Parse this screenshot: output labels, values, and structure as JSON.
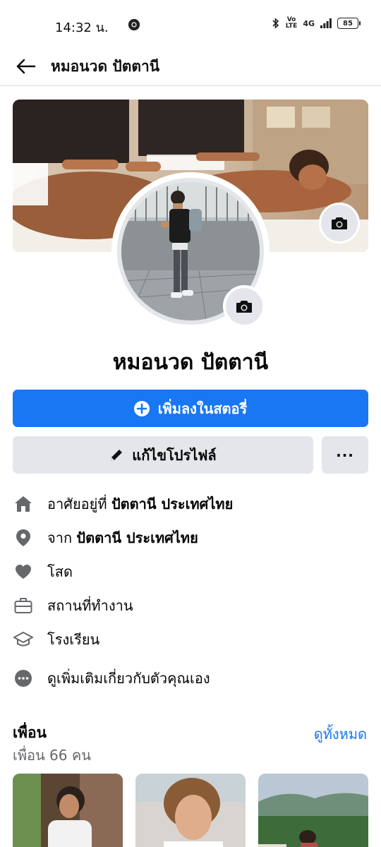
{
  "status_bar": {
    "time": "14:32 น.",
    "network_top": "Vo",
    "network_bottom": "LTE",
    "signal": "4G",
    "battery": "85"
  },
  "header": {
    "back_icon": "arrow-left-icon",
    "title": "หมอนวด ปัตตานี"
  },
  "profile": {
    "name": "หมอนวด ปัตตานี",
    "cover_camera_icon": "camera-icon",
    "avatar_camera_icon": "camera-icon"
  },
  "actions": {
    "add_story": "เพิ่มลงในสตอรี่",
    "edit_profile": "แก้ไขโปรไฟล์",
    "more": "···"
  },
  "details": [
    {
      "icon": "home-icon",
      "prefix": "อาศัยอยู่ที่ ",
      "bold": "ปัตตานี ประเทศไทย"
    },
    {
      "icon": "location-pin-icon",
      "prefix": "จาก ",
      "bold": "ปัตตานี ประเทศไทย"
    },
    {
      "icon": "heart-icon",
      "prefix": "โสด",
      "bold": ""
    },
    {
      "icon": "briefcase-icon",
      "prefix": "สถานที่ทำงาน",
      "bold": ""
    },
    {
      "icon": "graduation-cap-icon",
      "prefix": "โรงเรียน",
      "bold": ""
    },
    {
      "icon": "more-circle-icon",
      "prefix": "ดูเพิ่มเติมเกี่ยวกับตัวคุณเอง",
      "bold": ""
    }
  ],
  "friends": {
    "title": "เพื่อน",
    "count": "เพื่อน 66 คน",
    "see_all": "ดูทั้งหมด"
  },
  "colors": {
    "accent": "#1877f2",
    "button_gray": "#e4e6eb",
    "secondary_text": "#65676b"
  }
}
